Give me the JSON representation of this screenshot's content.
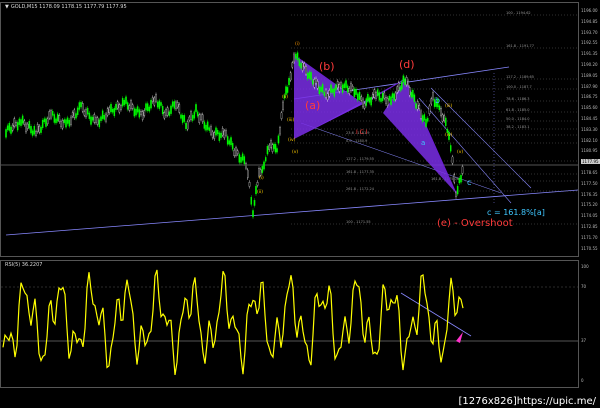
{
  "header": {
    "symbol_line": "GOLD,M15  1178.09 1178.15 1177.79 1177.95",
    "rsi_label": "RSI(5) 36.2207"
  },
  "price_axis": [
    "1196.00",
    "1194.85",
    "1193.70",
    "1192.55",
    "1191.35",
    "1190.20",
    "1189.05",
    "1187.90",
    "1186.75",
    "1185.60",
    "1184.45",
    "1183.30",
    "1182.10",
    "1180.95",
    "1179.80",
    "1178.65",
    "1177.50",
    "1176.35",
    "1175.20",
    "1174.05",
    "1172.85",
    "1171.70",
    "1170.55"
  ],
  "price_axis_marker": "1177.95",
  "rsi_axis": [
    "100",
    "70",
    "37",
    "0"
  ],
  "wave_labels": {
    "a": "(a)",
    "b": "(b)",
    "d": "(d)",
    "e": "(e) - Overshoot",
    "small_b": "b",
    "small_a": "a",
    "small_c": "c",
    "c_note": "c = 161.8%[a]",
    "ici": "I C I"
  },
  "roman_labels": [
    "(i)",
    "(ii)",
    "(iii)",
    "(iv)",
    "(v)",
    "(i)",
    "(ii)",
    "(iii)",
    "(iv)",
    "(v)"
  ],
  "fib_levels": [
    "100 - 1194.62",
    "161.8 - 1191.77",
    "127.2 - 1189.65",
    "100.0 - 1187.7",
    "78.6 - 1186.3",
    "61.8 - 1185.0",
    "50.0 - 1184.0",
    "38.2 - 1183.1",
    "23.6 - 1181.9",
    "0.0 - 1180.9",
    "127.2 - 1179.55",
    "161.8 - 1177.35",
    "261.8 - 1172.24",
    "161.8 - 1175.06",
    "100 - 1171.55"
  ],
  "watermark": "[1276x826]https://upic.me/",
  "colors": {
    "up_candle": "#00ff00",
    "down_candle": "#ffffff",
    "rsi_line": "#ffff00",
    "pattern_fill": "#7a2ee6",
    "wave_red": "#ff3b3b",
    "wave_cyan": "#3fc7ff",
    "trend_line": "#8888ff"
  }
}
